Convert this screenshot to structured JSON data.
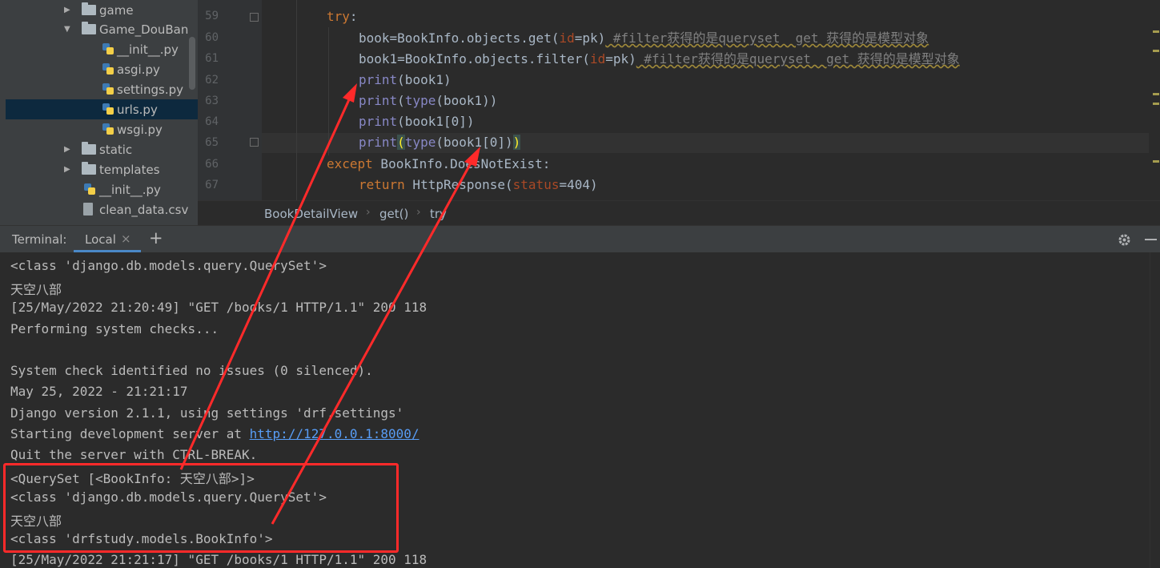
{
  "project_tree": {
    "items": [
      {
        "label": "game",
        "type": "folder",
        "expanded": false
      },
      {
        "label": "Game_DouBan",
        "type": "folder",
        "expanded": true
      },
      {
        "label": "__init__.py",
        "type": "python"
      },
      {
        "label": "asgi.py",
        "type": "python"
      },
      {
        "label": "settings.py",
        "type": "python"
      },
      {
        "label": "urls.py",
        "type": "python",
        "selected": true
      },
      {
        "label": "wsgi.py",
        "type": "python"
      },
      {
        "label": "static",
        "type": "folder",
        "expanded": false
      },
      {
        "label": "templates",
        "type": "folder",
        "expanded": false
      },
      {
        "label": "__init__.py",
        "type": "python"
      },
      {
        "label": "clean_data.csv",
        "type": "file"
      }
    ]
  },
  "editor": {
    "line_numbers": [
      "59",
      "60",
      "61",
      "62",
      "63",
      "64",
      "65",
      "66",
      "67"
    ],
    "code": {
      "l59_kw": "try",
      "l59_colon": ":",
      "l60_a": "book=BookInfo.objects.get(",
      "l60_p": "id",
      "l60_b": "=pk)",
      "l60_c": " #filter获得的是queryset  get 获得的是模型对象",
      "l61_a": "book1=BookInfo.objects.filter(",
      "l61_p": "id",
      "l61_b": "=pk)",
      "l61_c": " #filter获得的是queryset  get 获得的是模型对象",
      "print": "print",
      "type": "type",
      "l62_rest": "(book1)",
      "l63_open": "(",
      "l63_rest": "(book1))",
      "l64_rest": "(book1[0])",
      "l65_po": "(",
      "l65_mid": "(book1[0])",
      "l65_pc": ")",
      "l66_kw": "except",
      "l66_rest": " BookInfo.DoesNotExist:",
      "l67_kw": "return",
      "l67_a": " HttpResponse(",
      "l67_p": "status",
      "l67_b": "=404)"
    }
  },
  "breadcrumb": {
    "items": [
      "BookDetailView",
      "get()",
      "try"
    ],
    "separator": "›"
  },
  "terminal": {
    "title": "Terminal:",
    "tab": "Local",
    "close": "×",
    "add": "+",
    "lines": [
      "<class 'django.db.models.query.QuerySet'>",
      "天空八部",
      "[25/May/2022 21:20:49] \"GET /books/1 HTTP/1.1\" 200 118",
      "Performing system checks...",
      "",
      "System check identified no issues (0 silenced).",
      "May 25, 2022 - 21:21:17",
      "Django version 2.1.1, using settings 'drf.settings'",
      "Quit the server with CTRL-BREAK.",
      "<QuerySet [<BookInfo: 天空八部>]>",
      "<class 'django.db.models.query.QuerySet'>",
      "天空八部",
      "<class 'drfstudy.models.BookInfo'>",
      "[25/May/2022 21:21:17] \"GET /books/1 HTTP/1.1\" 200 118"
    ],
    "server_line_prefix": "Starting development server at ",
    "server_url": "http://127.0.0.1:8000/"
  },
  "colors": {
    "annotation_red": "#ff2a2a",
    "tab_underline": "#4a88c7"
  }
}
